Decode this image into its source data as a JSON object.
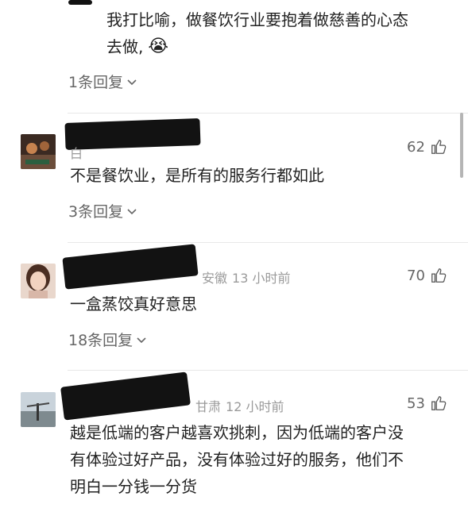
{
  "thread": {
    "nested_reply": {
      "text_line1": "我打比喻，做餐饮行业要抱着做慈善的心态",
      "text_line2": "去做,",
      "emoji": "😭",
      "replies": "1条回复"
    }
  },
  "comments": [
    {
      "username_fragment": "白",
      "location": "",
      "time": "",
      "likes": "62",
      "text": "不是餐饮业，是所有的服务行都如此",
      "replies": "3条回复"
    },
    {
      "username_fragment": "",
      "location": "安徽",
      "time": "13 小时前",
      "likes": "70",
      "text": "一盒蒸饺真好意思",
      "replies": "18条回复"
    },
    {
      "username_fragment": "",
      "location": "甘肃",
      "time": "12 小时前",
      "likes": "53",
      "text_line1": "越是低端的客户越喜欢挑刺，因为低端的客户没",
      "text_line2": "有体验过好产品，没有体验过好的服务，他们不",
      "text_line3": "明白一分钱一分货"
    }
  ],
  "icons": {
    "thumbs_up": "thumbs-up-icon",
    "chevron": "chevron-down-icon"
  },
  "colors": {
    "text": "#1a1a1a",
    "muted": "#666666",
    "meta": "#9a9a9a",
    "divider": "#e8e8e8",
    "redaction": "#121212"
  }
}
